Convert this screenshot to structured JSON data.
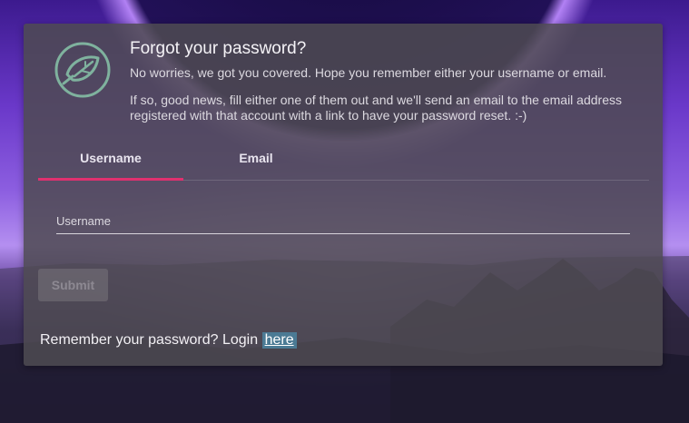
{
  "dialog": {
    "title": "Forgot your password?",
    "description_1": "No worries, we got you covered. Hope you remember either your username or email.",
    "description_2": "If so, good news, fill either one of them out and we'll send an email to the email address registered with that account with a link to have your password reset. :-)"
  },
  "tabs": [
    {
      "label": "Username",
      "active": true
    },
    {
      "label": "Email",
      "active": false
    }
  ],
  "form": {
    "username_label": "Username",
    "username_value": "",
    "submit_label": "Submit",
    "submit_disabled": true
  },
  "footer": {
    "text": "Remember your password? Login",
    "link_label": "here"
  },
  "colors": {
    "tab_indicator": "#e0306f",
    "logo": "#7fb29e",
    "link_highlight": "#4b7a94"
  },
  "icons": {
    "logo": "leaf-icon"
  }
}
